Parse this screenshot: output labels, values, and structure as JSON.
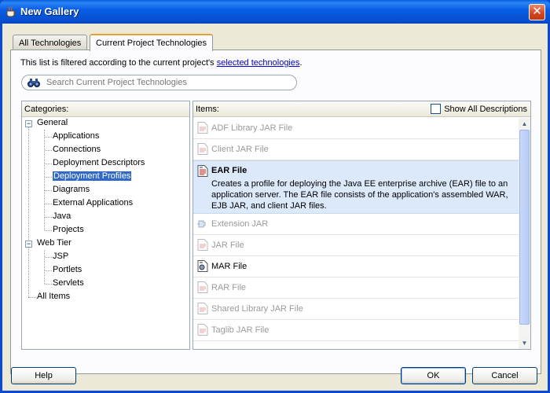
{
  "window": {
    "title": "New Gallery"
  },
  "tabs": [
    {
      "label": "All Technologies",
      "active": false
    },
    {
      "label": "Current Project Technologies",
      "active": true
    }
  ],
  "filter_note": {
    "text": "This list is filtered according to the current project's ",
    "link": "selected technologies",
    "suffix": "."
  },
  "search": {
    "placeholder": "Search Current Project Technologies",
    "value": ""
  },
  "categories": {
    "header": "Categories:",
    "items": [
      {
        "label": "General",
        "level": 0,
        "expanded": true
      },
      {
        "label": "Applications",
        "level": 1
      },
      {
        "label": "Connections",
        "level": 1
      },
      {
        "label": "Deployment Descriptors",
        "level": 1
      },
      {
        "label": "Deployment Profiles",
        "level": 1,
        "selected": true
      },
      {
        "label": "Diagrams",
        "level": 1
      },
      {
        "label": "External Applications",
        "level": 1
      },
      {
        "label": "Java",
        "level": 1
      },
      {
        "label": "Projects",
        "level": 1
      },
      {
        "label": "Web Tier",
        "level": 0,
        "expanded": true
      },
      {
        "label": "JSP",
        "level": 1
      },
      {
        "label": "Portlets",
        "level": 1
      },
      {
        "label": "Servlets",
        "level": 1
      },
      {
        "label": "All Items",
        "level": 0
      }
    ]
  },
  "items": {
    "header": "Items:",
    "show_all_label": "Show All Descriptions",
    "show_all_checked": false,
    "list": [
      {
        "name": "ADF Library JAR File",
        "enabled": false,
        "icon": "jar-file-icon"
      },
      {
        "name": "Client JAR File",
        "enabled": false,
        "icon": "jar-file-icon"
      },
      {
        "name": "EAR File",
        "enabled": true,
        "highlighted": true,
        "icon": "ear-file-icon",
        "description": "Creates a profile for deploying the Java EE enterprise archive (EAR) file to an application server.  The EAR file consists of the application's assembled WAR, EJB JAR, and client JAR files."
      },
      {
        "name": "Extension JAR",
        "enabled": false,
        "icon": "extension-icon"
      },
      {
        "name": "JAR File",
        "enabled": false,
        "icon": "jar-file-icon"
      },
      {
        "name": "MAR File",
        "enabled": true,
        "icon": "mar-file-icon"
      },
      {
        "name": "RAR File",
        "enabled": false,
        "icon": "jar-file-icon"
      },
      {
        "name": "Shared Library JAR File",
        "enabled": false,
        "icon": "jar-file-icon"
      },
      {
        "name": "Taglib JAR File",
        "enabled": false,
        "icon": "jar-file-icon"
      }
    ]
  },
  "buttons": {
    "help": "Help",
    "ok": "OK",
    "cancel": "Cancel"
  },
  "colors": {
    "title_bar": "#0a5fe6",
    "selection": "#316ac5",
    "highlight_row": "#dbe9fa",
    "link": "#0000cc",
    "dialog_bg": "#ece9d8"
  }
}
